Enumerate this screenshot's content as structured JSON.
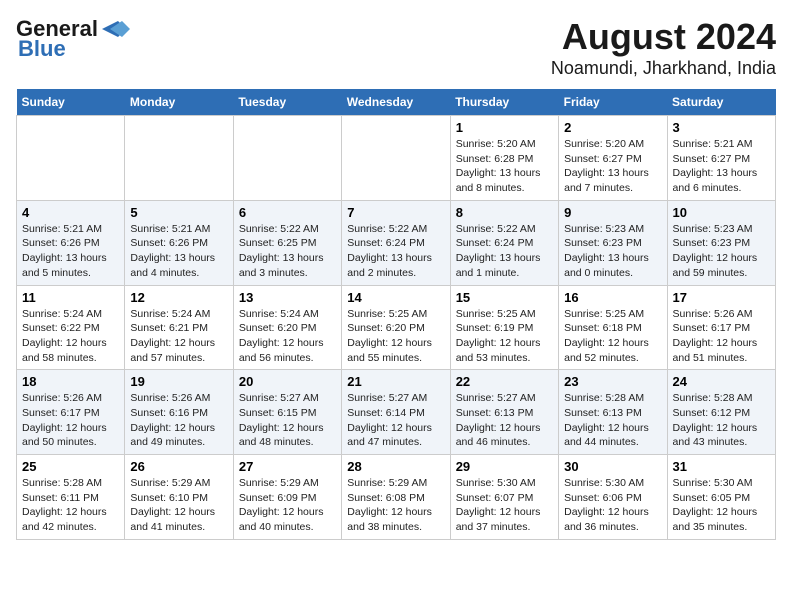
{
  "logo": {
    "line1": "General",
    "line2": "Blue"
  },
  "title": "August 2024",
  "subtitle": "Noamundi, Jharkhand, India",
  "days_of_week": [
    "Sunday",
    "Monday",
    "Tuesday",
    "Wednesday",
    "Thursday",
    "Friday",
    "Saturday"
  ],
  "weeks": [
    [
      {
        "day": "",
        "info": ""
      },
      {
        "day": "",
        "info": ""
      },
      {
        "day": "",
        "info": ""
      },
      {
        "day": "",
        "info": ""
      },
      {
        "day": "1",
        "info": "Sunrise: 5:20 AM\nSunset: 6:28 PM\nDaylight: 13 hours\nand 8 minutes."
      },
      {
        "day": "2",
        "info": "Sunrise: 5:20 AM\nSunset: 6:27 PM\nDaylight: 13 hours\nand 7 minutes."
      },
      {
        "day": "3",
        "info": "Sunrise: 5:21 AM\nSunset: 6:27 PM\nDaylight: 13 hours\nand 6 minutes."
      }
    ],
    [
      {
        "day": "4",
        "info": "Sunrise: 5:21 AM\nSunset: 6:26 PM\nDaylight: 13 hours\nand 5 minutes."
      },
      {
        "day": "5",
        "info": "Sunrise: 5:21 AM\nSunset: 6:26 PM\nDaylight: 13 hours\nand 4 minutes."
      },
      {
        "day": "6",
        "info": "Sunrise: 5:22 AM\nSunset: 6:25 PM\nDaylight: 13 hours\nand 3 minutes."
      },
      {
        "day": "7",
        "info": "Sunrise: 5:22 AM\nSunset: 6:24 PM\nDaylight: 13 hours\nand 2 minutes."
      },
      {
        "day": "8",
        "info": "Sunrise: 5:22 AM\nSunset: 6:24 PM\nDaylight: 13 hours\nand 1 minute."
      },
      {
        "day": "9",
        "info": "Sunrise: 5:23 AM\nSunset: 6:23 PM\nDaylight: 13 hours\nand 0 minutes."
      },
      {
        "day": "10",
        "info": "Sunrise: 5:23 AM\nSunset: 6:23 PM\nDaylight: 12 hours\nand 59 minutes."
      }
    ],
    [
      {
        "day": "11",
        "info": "Sunrise: 5:24 AM\nSunset: 6:22 PM\nDaylight: 12 hours\nand 58 minutes."
      },
      {
        "day": "12",
        "info": "Sunrise: 5:24 AM\nSunset: 6:21 PM\nDaylight: 12 hours\nand 57 minutes."
      },
      {
        "day": "13",
        "info": "Sunrise: 5:24 AM\nSunset: 6:20 PM\nDaylight: 12 hours\nand 56 minutes."
      },
      {
        "day": "14",
        "info": "Sunrise: 5:25 AM\nSunset: 6:20 PM\nDaylight: 12 hours\nand 55 minutes."
      },
      {
        "day": "15",
        "info": "Sunrise: 5:25 AM\nSunset: 6:19 PM\nDaylight: 12 hours\nand 53 minutes."
      },
      {
        "day": "16",
        "info": "Sunrise: 5:25 AM\nSunset: 6:18 PM\nDaylight: 12 hours\nand 52 minutes."
      },
      {
        "day": "17",
        "info": "Sunrise: 5:26 AM\nSunset: 6:17 PM\nDaylight: 12 hours\nand 51 minutes."
      }
    ],
    [
      {
        "day": "18",
        "info": "Sunrise: 5:26 AM\nSunset: 6:17 PM\nDaylight: 12 hours\nand 50 minutes."
      },
      {
        "day": "19",
        "info": "Sunrise: 5:26 AM\nSunset: 6:16 PM\nDaylight: 12 hours\nand 49 minutes."
      },
      {
        "day": "20",
        "info": "Sunrise: 5:27 AM\nSunset: 6:15 PM\nDaylight: 12 hours\nand 48 minutes."
      },
      {
        "day": "21",
        "info": "Sunrise: 5:27 AM\nSunset: 6:14 PM\nDaylight: 12 hours\nand 47 minutes."
      },
      {
        "day": "22",
        "info": "Sunrise: 5:27 AM\nSunset: 6:13 PM\nDaylight: 12 hours\nand 46 minutes."
      },
      {
        "day": "23",
        "info": "Sunrise: 5:28 AM\nSunset: 6:13 PM\nDaylight: 12 hours\nand 44 minutes."
      },
      {
        "day": "24",
        "info": "Sunrise: 5:28 AM\nSunset: 6:12 PM\nDaylight: 12 hours\nand 43 minutes."
      }
    ],
    [
      {
        "day": "25",
        "info": "Sunrise: 5:28 AM\nSunset: 6:11 PM\nDaylight: 12 hours\nand 42 minutes."
      },
      {
        "day": "26",
        "info": "Sunrise: 5:29 AM\nSunset: 6:10 PM\nDaylight: 12 hours\nand 41 minutes."
      },
      {
        "day": "27",
        "info": "Sunrise: 5:29 AM\nSunset: 6:09 PM\nDaylight: 12 hours\nand 40 minutes."
      },
      {
        "day": "28",
        "info": "Sunrise: 5:29 AM\nSunset: 6:08 PM\nDaylight: 12 hours\nand 38 minutes."
      },
      {
        "day": "29",
        "info": "Sunrise: 5:30 AM\nSunset: 6:07 PM\nDaylight: 12 hours\nand 37 minutes."
      },
      {
        "day": "30",
        "info": "Sunrise: 5:30 AM\nSunset: 6:06 PM\nDaylight: 12 hours\nand 36 minutes."
      },
      {
        "day": "31",
        "info": "Sunrise: 5:30 AM\nSunset: 6:05 PM\nDaylight: 12 hours\nand 35 minutes."
      }
    ]
  ]
}
